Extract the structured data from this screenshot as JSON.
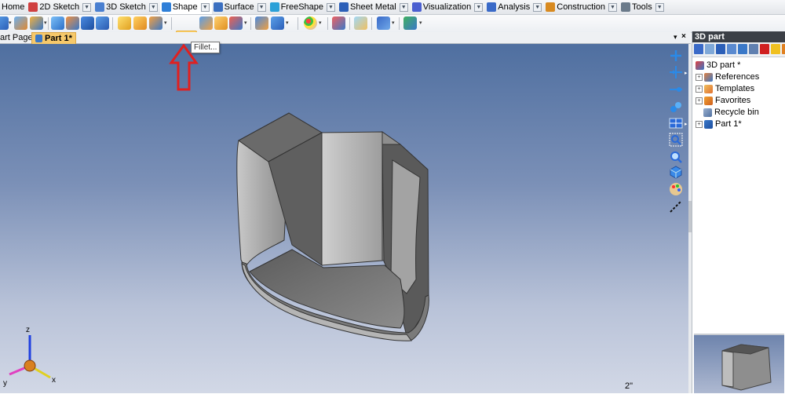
{
  "menubar": {
    "items": [
      {
        "label": "Home",
        "color": "#3a78c8"
      },
      {
        "label": "2D Sketch",
        "color": "#d04040"
      },
      {
        "label": "3D Sketch",
        "color": "#4a7fd0"
      },
      {
        "label": "Shape",
        "color": "#2f7fd8"
      },
      {
        "label": "Surface",
        "color": "#3b6fc0"
      },
      {
        "label": "FreeShape",
        "color": "#2aa0d8"
      },
      {
        "label": "Sheet Metal",
        "color": "#2c5fb8"
      },
      {
        "label": "Visualization",
        "color": "#4b5fd0"
      },
      {
        "label": "Analysis",
        "color": "#3a6ac8"
      },
      {
        "label": "Construction",
        "color": "#d88a20"
      },
      {
        "label": "Tools",
        "color": "#6a7a8a"
      }
    ],
    "active": "Shape"
  },
  "toolbar": {
    "highlighted_tool": "fillet-icon"
  },
  "tooltip": {
    "text": "Fillet..."
  },
  "document_tabs": [
    {
      "label": "art Page"
    },
    {
      "label": "Part 1*"
    }
  ],
  "viewport": {
    "scale_label": "2\"",
    "axis_labels": {
      "z": "z",
      "x": "x",
      "y": "y"
    }
  },
  "right_panel": {
    "title": "3D part",
    "tree": [
      {
        "label": "3D part *",
        "icon": "part-root-icon"
      },
      {
        "label": "References",
        "icon": "references-icon"
      },
      {
        "label": "Templates",
        "icon": "templates-icon"
      },
      {
        "label": "Favorites",
        "icon": "favorites-icon"
      },
      {
        "label": "Recycle bin",
        "icon": "recycle-bin-icon"
      },
      {
        "label": "Part 1*",
        "icon": "part-icon"
      }
    ]
  },
  "colors": {
    "accent": "#f7c96a",
    "arrow": "#e02020",
    "viewport_top": "#4f6fa0",
    "viewport_bottom": "#d2d8e6"
  }
}
